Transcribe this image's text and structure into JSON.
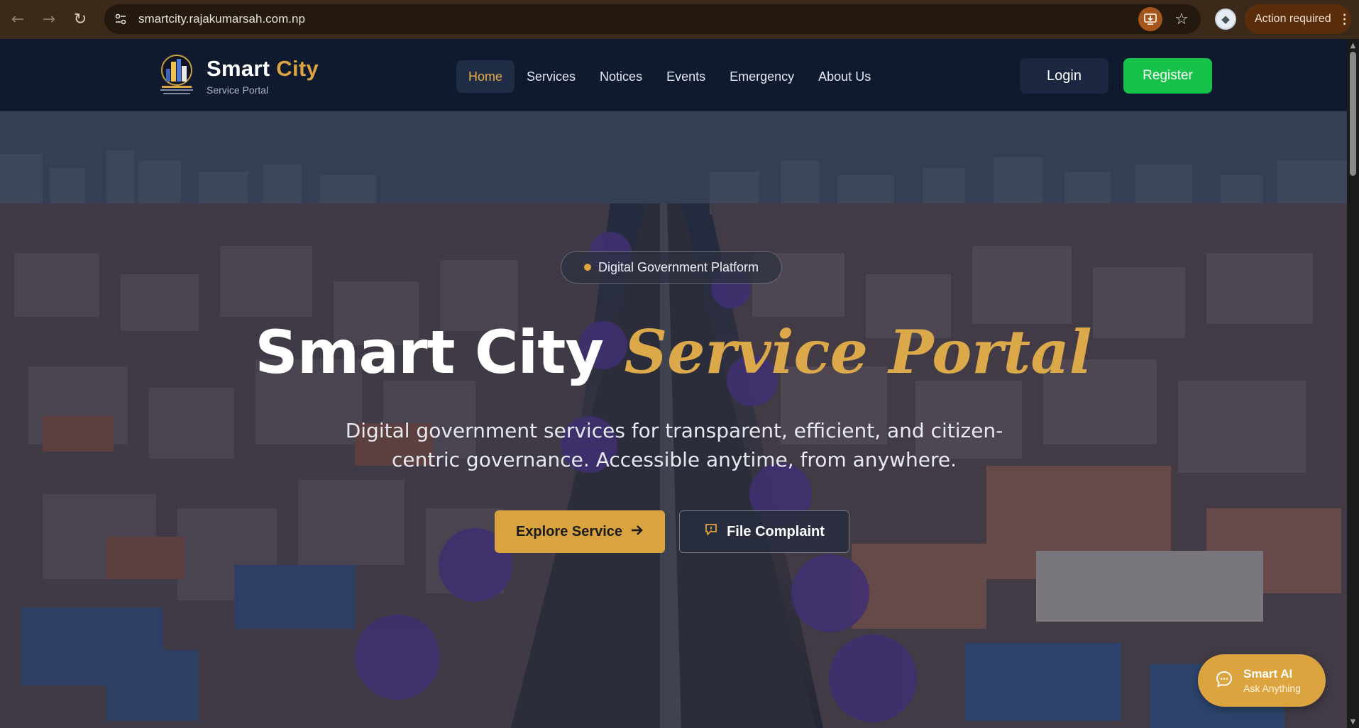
{
  "browser": {
    "url": "smartcity.rajakumarsah.com.np",
    "action_required_label": "Action required",
    "icons": [
      "back-arrow-icon",
      "forward-arrow-icon",
      "reload-icon",
      "site-info-icon",
      "install-app-icon",
      "bookmark-star-icon",
      "profile-icon",
      "more-menu-icon"
    ]
  },
  "header": {
    "brand_main": "Smart",
    "brand_accent": "City",
    "brand_sub": "Service Portal",
    "logo_text": "SMART CITY",
    "nav": [
      {
        "label": "Home",
        "active": true
      },
      {
        "label": "Services",
        "active": false
      },
      {
        "label": "Notices",
        "active": false
      },
      {
        "label": "Events",
        "active": false
      },
      {
        "label": "Emergency",
        "active": false
      },
      {
        "label": "About Us",
        "active": false
      }
    ],
    "login_label": "Login",
    "register_label": "Register"
  },
  "hero": {
    "badge": "Digital Government Platform",
    "title_main": "Smart City",
    "title_accent": "Service Portal",
    "description": "Digital government services for transparent, efficient, and citizen-centric governance. Accessible anytime, from anywhere.",
    "explore_label": "Explore Service",
    "complaint_label": "File Complaint"
  },
  "smart_ai": {
    "title": "Smart AI",
    "subtitle": "Ask Anything"
  },
  "colors": {
    "brand_accent": "#d9a441",
    "header_bg": "#0f1a2e",
    "register_green": "#16c24a",
    "active_nav_text": "#e8a948",
    "primary_button": "#d9a43f"
  }
}
